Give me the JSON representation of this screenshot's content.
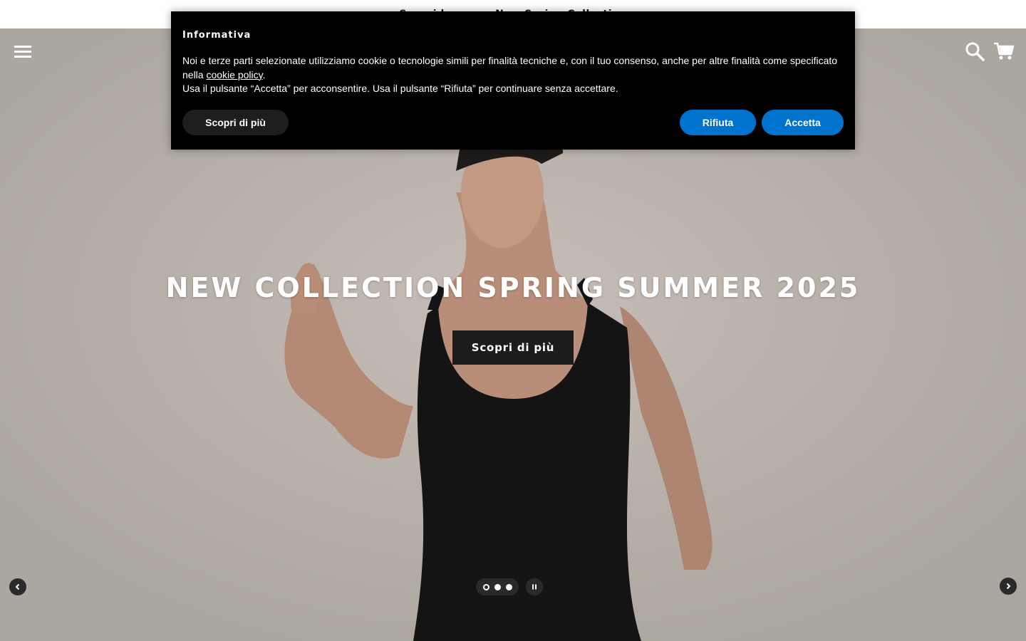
{
  "announcement": {
    "text": "Scopri la nuova New Spring Collection"
  },
  "header": {
    "menu_icon": "menu-icon",
    "search_icon": "search-icon",
    "cart_icon": "cart-icon"
  },
  "hero": {
    "title": "NEW COLLECTION SPRING SUMMER 2025",
    "cta_label": "Scopri di più",
    "slides": {
      "count": 3,
      "active_index": 0
    },
    "controls": {
      "prev_icon": "chevron-left-icon",
      "next_icon": "chevron-right-icon",
      "pause_icon": "pause-icon"
    }
  },
  "cookie_banner": {
    "title": "Informativa",
    "text_before_link": "Noi e terze parti selezionate utilizziamo cookie o tecnologie simili per finalità tecniche e, con il tuo consenso, anche per altre finalità come specificato nella ",
    "link_text": "cookie policy",
    "text_after_link": ".",
    "text_line2": "Usa il pulsante “Accetta” per acconsentire. Usa il pulsante “Rifiuta” per continuare senza accettare.",
    "learn_more_label": "Scopri di più",
    "reject_label": "Rifiuta",
    "accept_label": "Accetta"
  },
  "colors": {
    "cookie_bg": "#000000",
    "accent_blue": "#0073ce",
    "cta_bg": "#1c1c1c"
  }
}
